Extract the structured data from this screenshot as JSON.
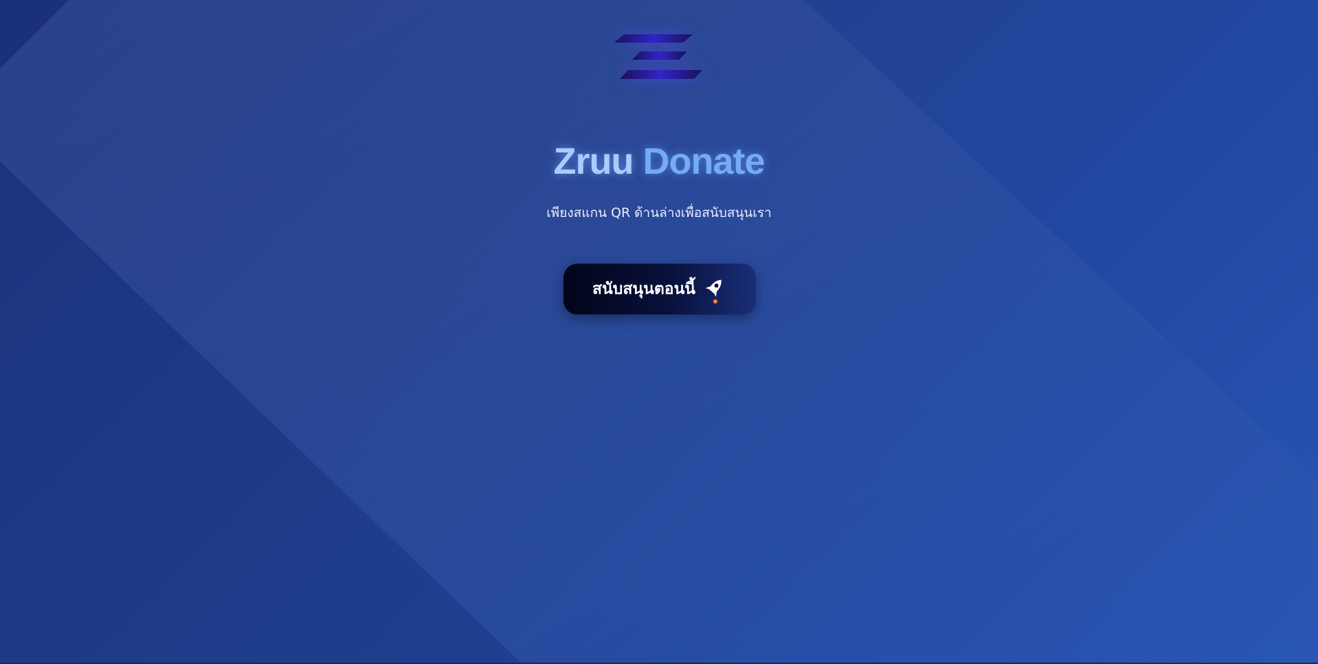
{
  "brand": {
    "logo_icon": "z-logo-icon",
    "title_part1": "Zruu",
    "title_part2": "Donate"
  },
  "hero": {
    "subtitle": "เพียงสแกน QR ด้านล่างเพื่อสนับสนุนเรา"
  },
  "cta": {
    "label": "สนับสนุนตอนนี้",
    "icon": "rocket-icon"
  },
  "colors": {
    "background_start": "#1d3582",
    "background_end": "#2755b4",
    "title_light": "#a9ccff",
    "title_accent": "#75aaf6",
    "button_dark": "#02051a",
    "logo_purple": "#2c20b8"
  }
}
